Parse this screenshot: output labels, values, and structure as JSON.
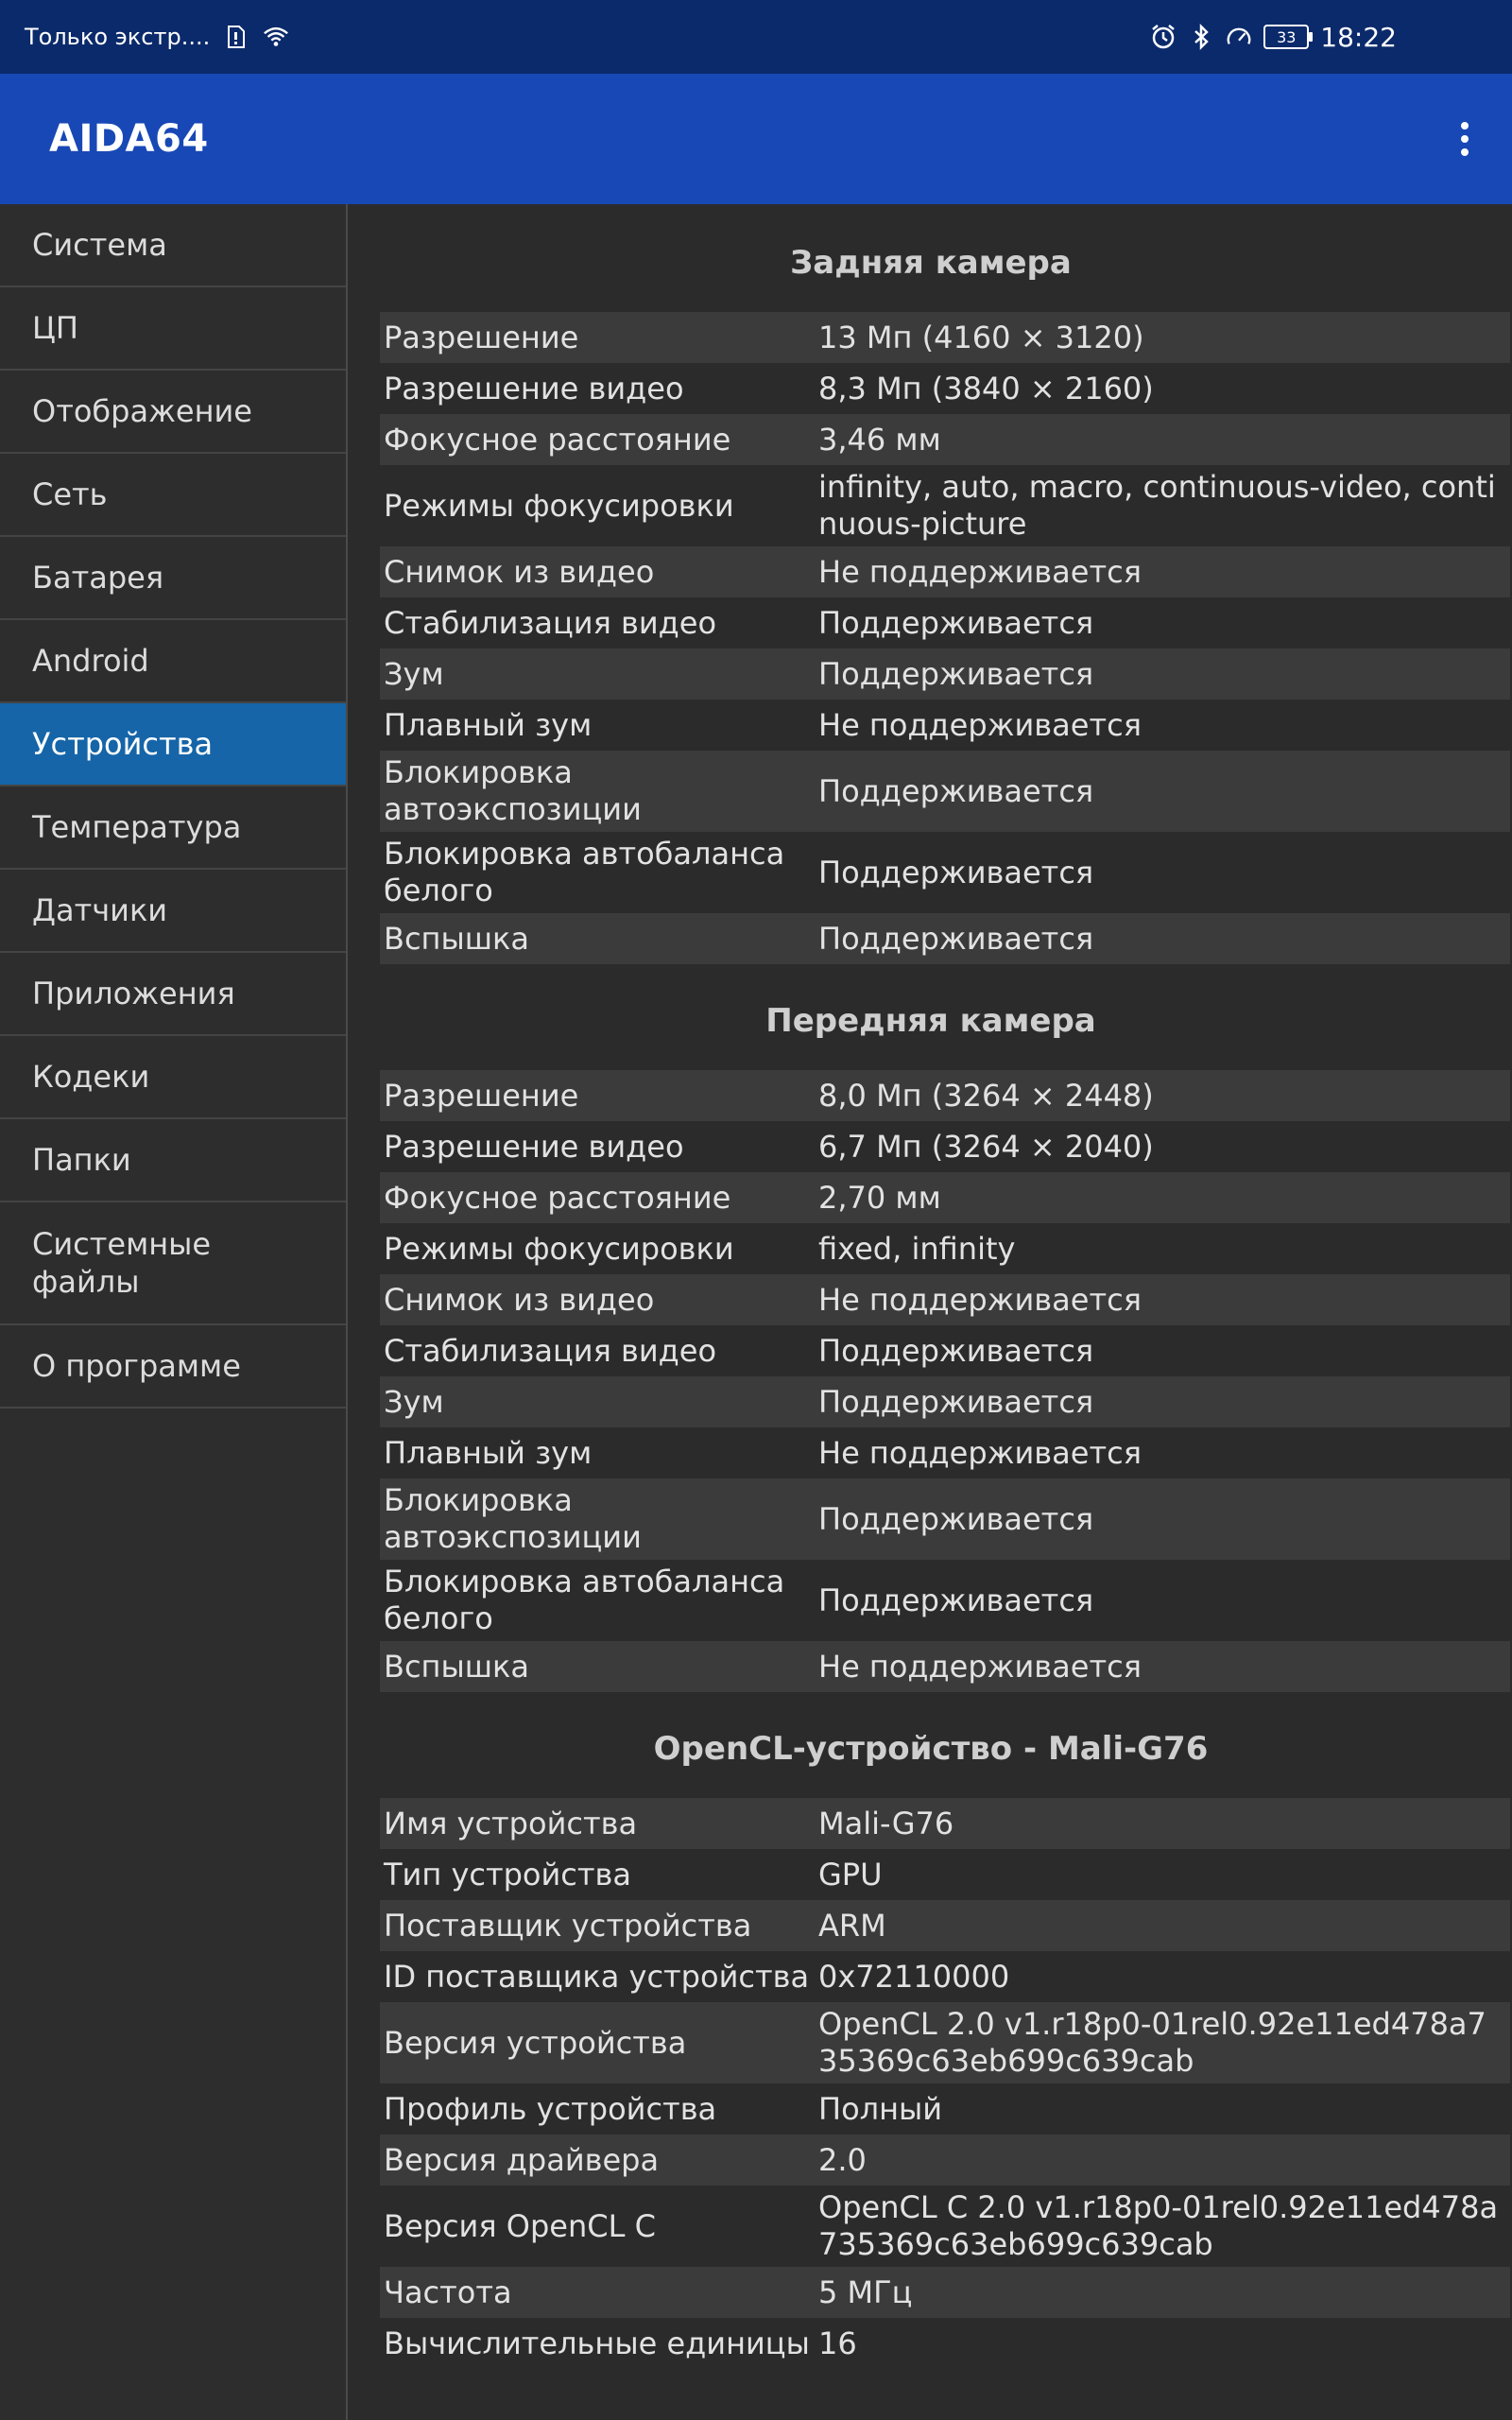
{
  "status_bar": {
    "left_text": "Только экстр....",
    "time": "18:22",
    "battery_level": "33",
    "icons": [
      "sim-icon",
      "wifi-icon",
      "alarm-icon",
      "bluetooth-icon",
      "speedometer-icon",
      "battery-icon"
    ]
  },
  "app": {
    "title": "AIDA64",
    "menu_icon": "more-vert-icon"
  },
  "sidebar": {
    "items": [
      {
        "label": "Система"
      },
      {
        "label": "ЦП"
      },
      {
        "label": "Отображение"
      },
      {
        "label": "Сеть"
      },
      {
        "label": "Батарея"
      },
      {
        "label": "Android"
      },
      {
        "label": "Устройства",
        "active": true
      },
      {
        "label": "Температура"
      },
      {
        "label": "Датчики"
      },
      {
        "label": "Приложения"
      },
      {
        "label": "Кодеки"
      },
      {
        "label": "Папки"
      },
      {
        "label": "Системные\nфайлы"
      },
      {
        "label": "О программе"
      }
    ]
  },
  "sections": [
    {
      "title": "Задняя камера",
      "rows": [
        {
          "label": "Разрешение",
          "value": "13 Мп (4160 × 3120)"
        },
        {
          "label": "Разрешение видео",
          "value": "8,3 Мп (3840 × 2160)"
        },
        {
          "label": "Фокусное расстояние",
          "value": "3,46 мм"
        },
        {
          "label": "Режимы фокусировки",
          "value": "infinity, auto, macro, continuous-video, continuous-picture"
        },
        {
          "label": "Снимок из видео",
          "value": "Не поддерживается"
        },
        {
          "label": "Стабилизация видео",
          "value": "Поддерживается"
        },
        {
          "label": "Зум",
          "value": "Поддерживается"
        },
        {
          "label": "Плавный зум",
          "value": "Не поддерживается"
        },
        {
          "label": "Блокировка автоэкспозиции",
          "value": "Поддерживается"
        },
        {
          "label": "Блокировка автобаланса белого",
          "value": "Поддерживается"
        },
        {
          "label": "Вспышка",
          "value": "Поддерживается"
        }
      ]
    },
    {
      "title": "Передняя камера",
      "rows": [
        {
          "label": "Разрешение",
          "value": "8,0 Мп (3264 × 2448)"
        },
        {
          "label": "Разрешение видео",
          "value": "6,7 Мп (3264 × 2040)"
        },
        {
          "label": "Фокусное расстояние",
          "value": "2,70 мм"
        },
        {
          "label": "Режимы фокусировки",
          "value": "fixed, infinity"
        },
        {
          "label": "Снимок из видео",
          "value": "Не поддерживается"
        },
        {
          "label": "Стабилизация видео",
          "value": "Поддерживается"
        },
        {
          "label": "Зум",
          "value": "Поддерживается"
        },
        {
          "label": "Плавный зум",
          "value": "Не поддерживается"
        },
        {
          "label": "Блокировка автоэкспозиции",
          "value": "Поддерживается"
        },
        {
          "label": "Блокировка автобаланса белого",
          "value": "Поддерживается"
        },
        {
          "label": "Вспышка",
          "value": "Не поддерживается"
        }
      ]
    },
    {
      "title": "OpenCL-устройство - Mali-G76",
      "rows": [
        {
          "label": "Имя устройства",
          "value": "Mali-G76"
        },
        {
          "label": "Тип устройства",
          "value": "GPU"
        },
        {
          "label": "Поставщик устройства",
          "value": "ARM"
        },
        {
          "label": "ID поставщика устройства",
          "value": "0x72110000"
        },
        {
          "label": "Версия устройства",
          "value": "OpenCL 2.0 v1.r18p0-01rel0.92e11ed478a735369c63eb699c639cab"
        },
        {
          "label": "Профиль устройства",
          "value": "Полный"
        },
        {
          "label": "Версия драйвера",
          "value": "2.0"
        },
        {
          "label": "Версия OpenCL C",
          "value": "OpenCL C 2.0 v1.r18p0-01rel0.92e11ed478a735369c63eb699c639cab"
        },
        {
          "label": "Частота",
          "value": "5 МГц"
        },
        {
          "label": "Вычислительные единицы",
          "value": "16"
        }
      ]
    }
  ]
}
